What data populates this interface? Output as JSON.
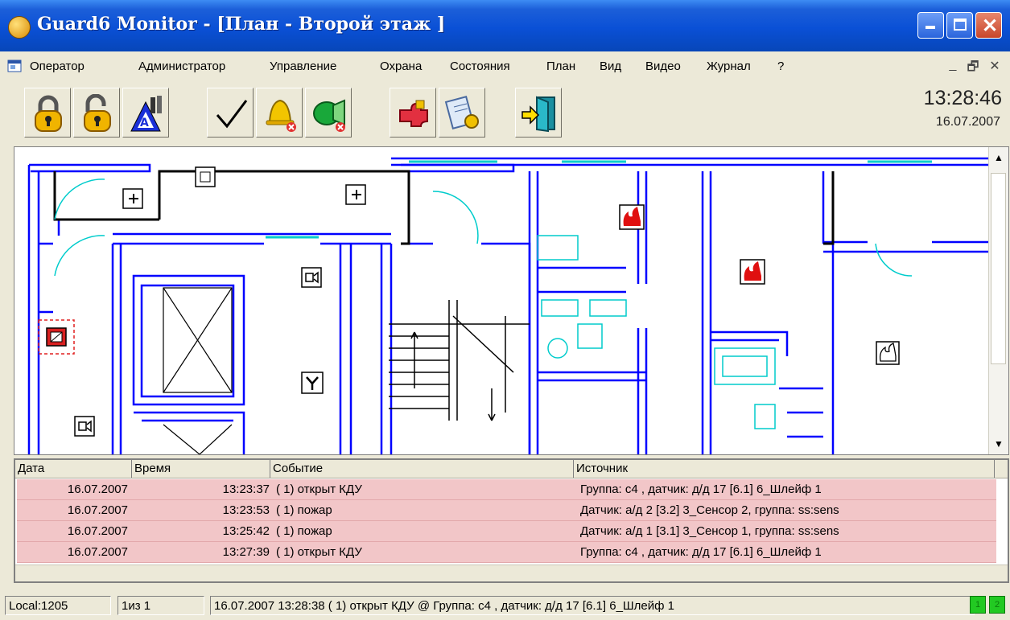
{
  "window": {
    "title": "Guard6 Monitor - [План - Второй этаж ]"
  },
  "menu": {
    "items": [
      "Оператор",
      "Администратор",
      "Управление",
      "Охрана",
      "Состояния",
      "План",
      "Вид",
      "Видео",
      "Журнал",
      "?"
    ]
  },
  "toolbar": {
    "buttons": [
      {
        "icon": "padlock-closed-icon"
      },
      {
        "icon": "padlock-open-icon"
      },
      {
        "icon": "arm-zones-icon"
      },
      {
        "icon": "checkmark-icon"
      },
      {
        "icon": "bell-muted-icon"
      },
      {
        "icon": "siren-muted-icon"
      },
      {
        "icon": "puzzle-icon"
      },
      {
        "icon": "document-seal-icon"
      },
      {
        "icon": "exit-door-icon"
      }
    ]
  },
  "clock": {
    "time": "13:28:46",
    "date": "16.07.2007"
  },
  "log": {
    "columns": [
      "Дата",
      "Время",
      "Событие",
      "Источник"
    ],
    "rows": [
      {
        "date": "16.07.2007",
        "time": "13:23:37",
        "event": "( 1) открыт КДУ",
        "source": "Группа: с4 , датчик: д/д 17 [6.1] 6_Шлейф 1"
      },
      {
        "date": "16.07.2007",
        "time": "13:23:53",
        "event": "( 1) пожар",
        "source": "Датчик: а/д 2 [3.2] 3_Сенсор 2, группа: ss:sens"
      },
      {
        "date": "16.07.2007",
        "time": "13:25:42",
        "event": "( 1) пожар",
        "source": "Датчик: а/д 1 [3.1] 3_Сенсор 1, группа: ss:sens"
      },
      {
        "date": "16.07.2007",
        "time": "13:27:39",
        "event": "( 1) открыт КДУ",
        "source": "Группа: с4 , датчик: д/д 17 [6.1] 6_Шлейф 1"
      }
    ]
  },
  "status": {
    "connection": "Local:1205",
    "page": "1из 1",
    "message": "16.07.2007 13:28:38 ( 1) открыт КДУ @ Группа: с4 , датчик: д/д 17 [6.1] 6_Шлейф 1",
    "led1": "1",
    "led2": "2"
  },
  "colors": {
    "wall": "#0000ff",
    "window": "#00cccc",
    "alarm_row": "#f2c6c8"
  }
}
